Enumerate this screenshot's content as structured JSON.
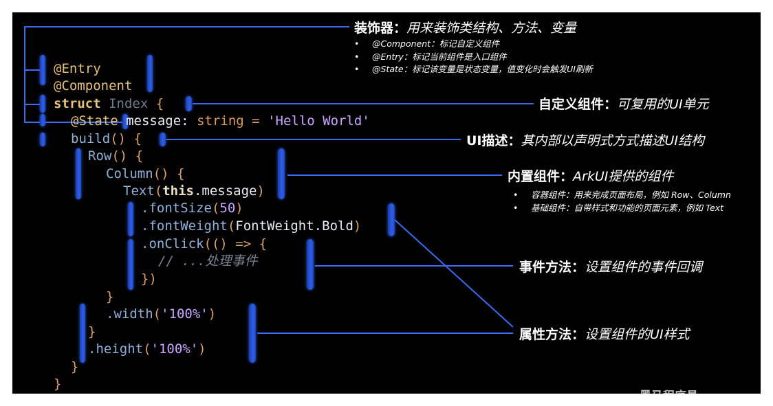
{
  "code": {
    "l1": "@Entry",
    "l2": "@Component",
    "l3_kw": "struct",
    "l3_name": "Index",
    "l3_brace": "{",
    "l4_dec": "@State",
    "l4_var": "message",
    "l4_colon": ":",
    "l4_type": "string",
    "l4_eq": "=",
    "l4_str": "'Hello World'",
    "l5_fn": "build",
    "l5_paren": "()",
    "l5_brace": "{",
    "l6_fn": "Row",
    "l6_paren": "()",
    "l6_brace": "{",
    "l7_fn": "Column",
    "l7_paren": "()",
    "l7_brace": "{",
    "l8_fn": "Text",
    "l8_open": "(",
    "l8_this": "this",
    "l8_prop": ".message",
    "l8_close": ")",
    "l9_fn": ".fontSize",
    "l9_open": "(",
    "l9_num": "50",
    "l9_close": ")",
    "l10_fn": ".fontWeight",
    "l10_open": "(",
    "l10_arg": "FontWeight.Bold",
    "l10_close": ")",
    "l11_fn": ".onClick",
    "l11_rest": "(() => {",
    "l12": "// ...处理事件",
    "l13": "})",
    "l14": "}",
    "l15_fn": ".width",
    "l15_open": "(",
    "l15_str": "'100%'",
    "l15_close": ")",
    "l16": "}",
    "l17_fn": ".height",
    "l17_open": "(",
    "l17_str": "'100%'",
    "l17_close": ")",
    "l18": "}",
    "l19": "}"
  },
  "annotations": {
    "decorator": {
      "title": "装饰器",
      "sep": "：",
      "desc": "用来装饰类结构、方法、变量",
      "bullets": [
        "@Component：标记自定义组件",
        "@Entry：标记当前组件是入口组件",
        "@State：标记该变量是状态变量，值变化时会触发UI刷新"
      ]
    },
    "custom": {
      "title": "自定义组件",
      "sep": "：",
      "desc": "可复用的UI单元"
    },
    "ui": {
      "title": "UI描述",
      "sep": "：",
      "desc": "其内部以声明式方式描述UI结构"
    },
    "builtin": {
      "title": "内置组件",
      "sep": "：",
      "desc": "ArkUI提供的组件",
      "bullets": [
        "容器组件：用来完成页面布局，例如 Row、Column",
        "基础组件：自带样式和功能的页面元素，例如 Text"
      ]
    },
    "event": {
      "title": "事件方法",
      "sep": "：",
      "desc": "设置组件的事件回调"
    },
    "attr": {
      "title": "属性方法",
      "sep": "：",
      "desc": "设置组件的UI样式"
    }
  },
  "watermark": "黑马程序员",
  "colors": {
    "background": "#000000",
    "bracket": "#2f5fe6",
    "line": "#3a6cf0",
    "keyword": "#e4c07a",
    "identifier": "#8fb1d8",
    "string": "#c9a6ff"
  }
}
